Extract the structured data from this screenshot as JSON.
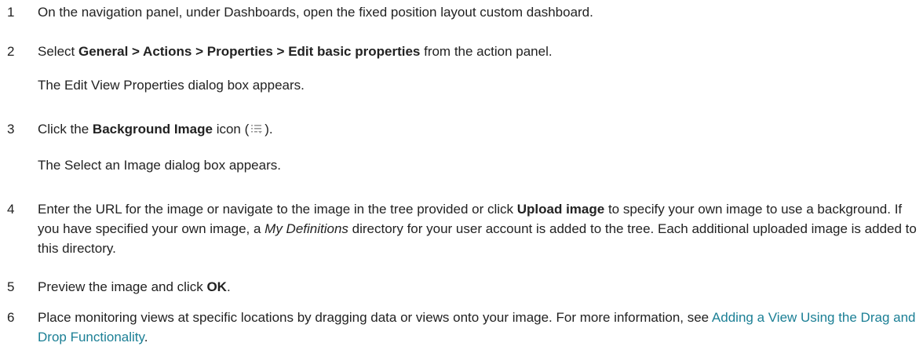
{
  "steps": [
    {
      "num": "1",
      "text": "On the navigation panel, under Dashboards, open the fixed position layout custom dashboard."
    },
    {
      "num": "2",
      "pre": "Select ",
      "bold": "General > Actions > Properties > Edit basic properties",
      "post": " from the action panel.",
      "note": "The Edit View Properties dialog box appears."
    },
    {
      "num": "3",
      "pre": "Click the ",
      "bold": "Background Image",
      "mid": " icon (",
      "icon": "list-options-icon",
      "post": ").",
      "note": "The Select an Image dialog box appears."
    },
    {
      "num": "4",
      "pre": "Enter the URL for the image or navigate to the image in the tree provided or click ",
      "bold": "Upload image",
      "mid": " to specify your own image to use a background. If you have specified your own image, a ",
      "italic": "My Definitions",
      "post": " directory for your user account is added to the tree. Each additional uploaded image is added to this directory."
    },
    {
      "num": "5",
      "pre": "Preview the image and click ",
      "bold": "OK",
      "post": "."
    },
    {
      "num": "6",
      "pre": "Place monitoring views at specific locations by dragging data or views onto your image. For more information, see ",
      "link": "Adding a View Using the Drag and Drop Functionality",
      "post": "."
    }
  ],
  "colors": {
    "text": "#222222",
    "link": "#1b7f95",
    "icon": "#9a9a9a"
  }
}
